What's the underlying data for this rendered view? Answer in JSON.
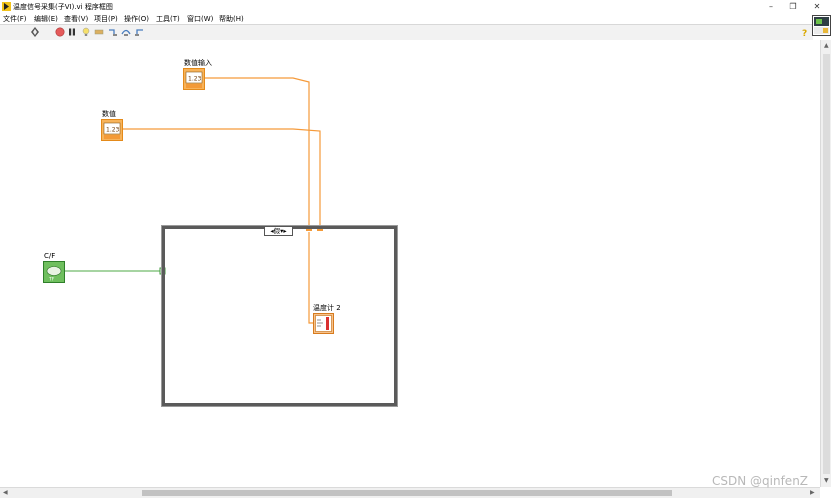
{
  "window": {
    "title": "温度信号采集(子VI).vi 程序框图",
    "minimize": "–",
    "restore": "❐",
    "close": "✕"
  },
  "menu": [
    "文件(F)",
    "编辑(E)",
    "查看(V)",
    "项目(P)",
    "操作(O)",
    "工具(T)",
    "窗口(W)",
    "帮助(H)"
  ],
  "toolbar": {
    "help_icon": "question-icon"
  },
  "diagram": {
    "controls": [
      {
        "label": "数值输入",
        "type": "numeric-control-dbl"
      },
      {
        "label": "数值",
        "type": "numeric-control-dbl"
      },
      {
        "label": "C/F",
        "type": "boolean-control"
      }
    ],
    "indicator": {
      "label": "温度计 2",
      "type": "thermometer-indicator"
    },
    "case_selector": "假",
    "colors": {
      "numeric_wire": "#f59a3a",
      "boolean_wire": "#4caa45",
      "numeric_terminal": "#f39a38",
      "boolean_terminal": "#3e9a3a"
    }
  },
  "watermark": "CSDN @qinfenZ"
}
